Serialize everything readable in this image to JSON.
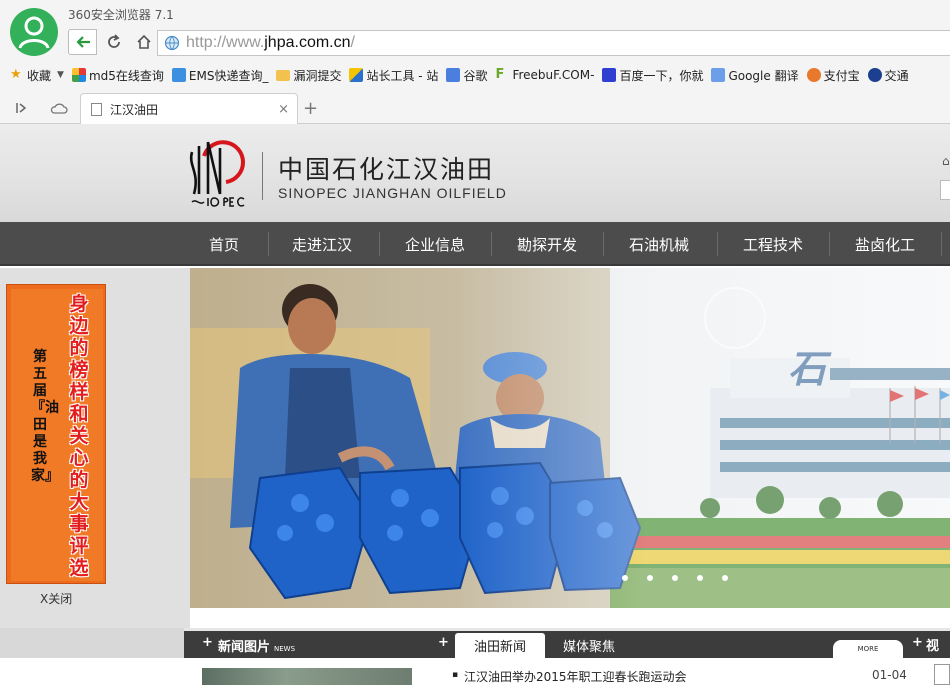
{
  "browser": {
    "window_title": "360安全浏览器 7.1",
    "url_prefix": "http://www.",
    "url_domain": "jhpa.com.cn",
    "url_suffix": "/",
    "bookmarks": [
      {
        "label": "收藏",
        "icon": "star-icon"
      },
      {
        "label": "md5在线查询",
        "icon": "grid-icon"
      },
      {
        "label": "EMS快递查询_",
        "icon": "ie-icon"
      },
      {
        "label": "漏洞提交",
        "icon": "folder-icon"
      },
      {
        "label": "站长工具 - 站",
        "icon": "chart-icon"
      },
      {
        "label": "谷歌",
        "icon": "google-icon"
      },
      {
        "label": "FreebuF.COM-",
        "icon": "freebuf-icon"
      },
      {
        "label": "百度一下，你就",
        "icon": "baidu-icon"
      },
      {
        "label": "Google 翻译",
        "icon": "translate-icon"
      },
      {
        "label": "支付宝",
        "icon": "alipay-icon"
      },
      {
        "label": "交通",
        "icon": "traffic-icon"
      }
    ],
    "tab_title": "江汉油田",
    "tab_close": "×",
    "new_tab": "+"
  },
  "site": {
    "cn_name": "中国石化江汉油田",
    "en_name": "SINOPEC JIANGHAN OILFIELD",
    "nav": [
      "首页",
      "走进江汉",
      "企业信息",
      "勘探开发",
      "石油机械",
      "工程技术",
      "盐卤化工"
    ],
    "promo": {
      "main": "身边的榜样和关心的大事评选",
      "side": "第五届『油田是我家』",
      "close": "X关闭"
    },
    "banner": {
      "overlay_char": "石"
    },
    "sections": {
      "news_pics": "新闻图片",
      "news_pics_en": "NEWS",
      "tab_active": "油田新闻",
      "tab_inactive": "媒体聚焦",
      "more": "MORE",
      "video": "视"
    },
    "news": [
      {
        "title": "江汉油田举办2015年职工迎春长跑运动会",
        "date": "01-04"
      }
    ]
  },
  "colors": {
    "nav_bg": "#4c4c4c",
    "promo_bg": "#ec6b1c",
    "promo_text": "#e31d1d",
    "avatar": "#33b05a"
  }
}
